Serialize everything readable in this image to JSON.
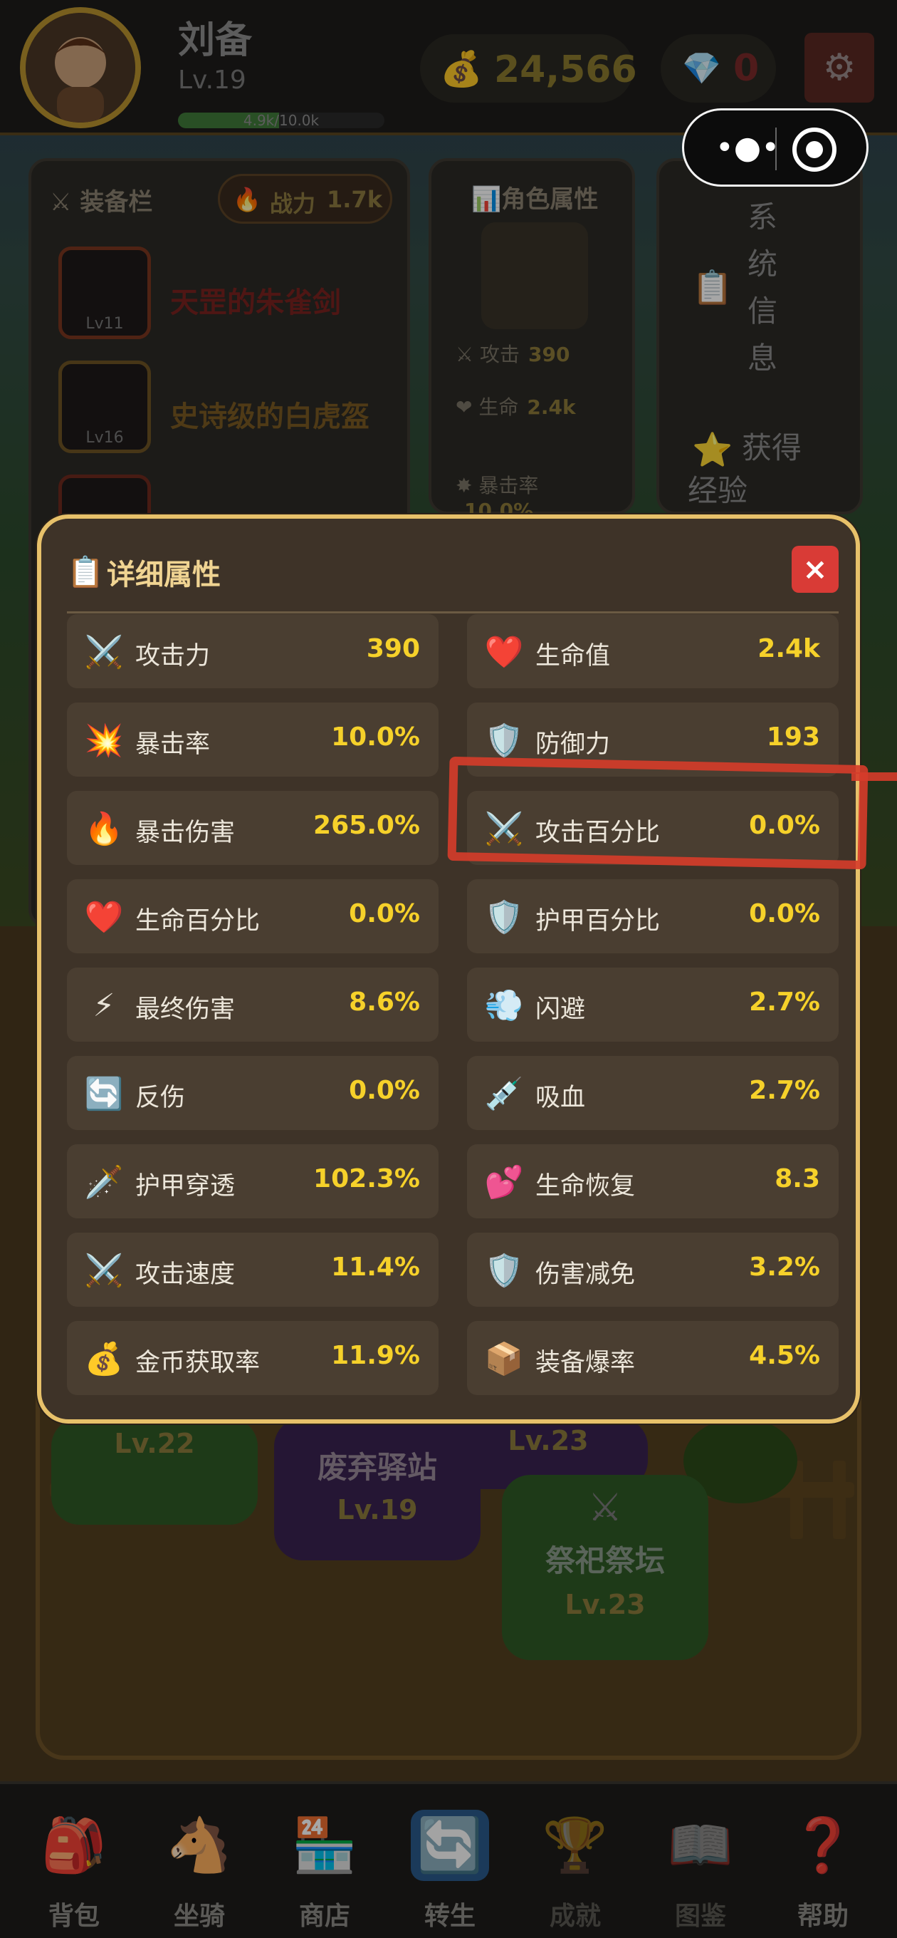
{
  "player": {
    "name": "刘备",
    "level": "Lv.19",
    "xp_text": "4.9k/10.0k",
    "xp_fraction": 0.49
  },
  "currency": {
    "coins": "24,566",
    "gems": "0"
  },
  "icons": {
    "avatar": "avatar-portrait",
    "coin": "money-bag-icon",
    "gem": "diamond-icon",
    "settings": "gear-icon",
    "capsule_more": "more-dots-icon",
    "capsule_close": "target-icon"
  },
  "equipment_panel": {
    "title": "装备栏",
    "power_label": "战力",
    "power_value": "1.7k",
    "items": [
      {
        "name": "天罡的朱雀剑",
        "level": "Lv11",
        "color": "#7a2220"
      },
      {
        "name": "史诗级的白虎盔",
        "level": "Lv16",
        "color": "#7a5a22"
      }
    ]
  },
  "attributes_panel": {
    "title": "角色属性",
    "rows": [
      {
        "label": "攻击",
        "value": "390"
      },
      {
        "label": "生命",
        "value": "2.4k"
      },
      {
        "label": "暴击率",
        "value": "10.0%"
      }
    ]
  },
  "system_panel": {
    "title": "系统信息",
    "gain_text": "获得",
    "gain_text2": "经验"
  },
  "locations": [
    {
      "name": "",
      "level": "Lv.22"
    },
    {
      "name": "废弃驿站",
      "level": "Lv.19"
    },
    {
      "name": "",
      "level": "Lv.23"
    },
    {
      "name": "祭祀祭坛",
      "level": "Lv.23"
    }
  ],
  "modal": {
    "title": "详细属性",
    "close_label": "×",
    "stats": [
      {
        "label": "攻击力",
        "value": "390",
        "icon": "⚔️",
        "icon_name": "swords-icon"
      },
      {
        "label": "生命值",
        "value": "2.4k",
        "icon": "❤️",
        "icon_name": "heart-icon"
      },
      {
        "label": "暴击率",
        "value": "10.0%",
        "icon": "💥",
        "icon_name": "burst-icon"
      },
      {
        "label": "防御力",
        "value": "193",
        "icon": "🛡️",
        "icon_name": "shield-icon"
      },
      {
        "label": "暴击伤害",
        "value": "265.0%",
        "icon": "🔥",
        "icon_name": "fire-icon"
      },
      {
        "label": "攻击百分比",
        "value": "0.0%",
        "icon": "⚔️",
        "icon_name": "swords-icon"
      },
      {
        "label": "生命百分比",
        "value": "0.0%",
        "icon": "❤️",
        "icon_name": "heart-icon"
      },
      {
        "label": "护甲百分比",
        "value": "0.0%",
        "icon": "🛡️",
        "icon_name": "shield-icon"
      },
      {
        "label": "最终伤害",
        "value": "8.6%",
        "icon": "⚡",
        "icon_name": "lightning-icon"
      },
      {
        "label": "闪避",
        "value": "2.7%",
        "icon": "💨",
        "icon_name": "dash-icon"
      },
      {
        "label": "反伤",
        "value": "0.0%",
        "icon": "🔄",
        "icon_name": "reflect-icon"
      },
      {
        "label": "吸血",
        "value": "2.7%",
        "icon": "💉",
        "icon_name": "syringe-icon"
      },
      {
        "label": "护甲穿透",
        "value": "102.3%",
        "icon": "🗡️",
        "icon_name": "dagger-icon"
      },
      {
        "label": "生命恢复",
        "value": "8.3",
        "icon": "💕",
        "icon_name": "hearts-icon"
      },
      {
        "label": "攻击速度",
        "value": "11.4%",
        "icon": "⚔️",
        "icon_name": "swords-icon"
      },
      {
        "label": "伤害减免",
        "value": "3.2%",
        "icon": "🛡️",
        "icon_name": "shield-icon"
      },
      {
        "label": "金币获取率",
        "value": "11.9%",
        "icon": "💰",
        "icon_name": "money-bag-icon"
      },
      {
        "label": "装备爆率",
        "value": "4.5%",
        "icon": "📦",
        "icon_name": "box-icon"
      }
    ]
  },
  "bottom_nav": [
    {
      "label": "背包",
      "icon": "🎒",
      "icon_name": "backpack-icon"
    },
    {
      "label": "坐骑",
      "icon": "🐴",
      "icon_name": "horse-icon"
    },
    {
      "label": "商店",
      "icon": "🏪",
      "icon_name": "shop-icon"
    },
    {
      "label": "转生",
      "icon": "🔄",
      "icon_name": "rebirth-icon"
    },
    {
      "label": "成就",
      "icon": "🏆",
      "icon_name": "trophy-icon"
    },
    {
      "label": "图鉴",
      "icon": "📖",
      "icon_name": "book-icon"
    },
    {
      "label": "帮助",
      "icon": "❓",
      "icon_name": "question-icon"
    }
  ],
  "colors": {
    "accent_gold": "#f6d12a",
    "modal_border": "#e7c16a",
    "close_red": "#d93b36",
    "annotation_red": "#d63c2a"
  }
}
